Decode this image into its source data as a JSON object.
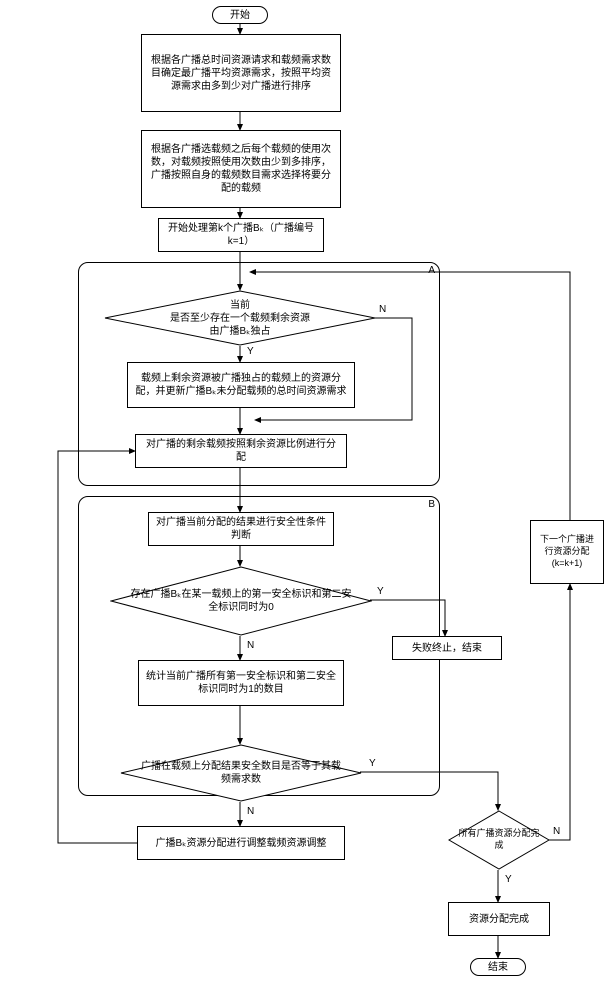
{
  "terminals": {
    "start": "开始",
    "end": "结束"
  },
  "steps": {
    "s1": "根据各广播总时间资源请求和载频需求数目确定最广播平均资源需求，按照平均资源需求由多到少对广播进行排序",
    "s2": "根据各广播选载频之后每个载频的使用次数，对载频按照使用次数由少到多排序，广播按照自身的载频数目需求选择将要分配的载频",
    "s3": "开始处理第k个广播Bₖ（广播编号k=1）",
    "s4": "载频上剩余资源被广播独占的载频上的资源分配，并更新广播Bₖ未分配载频的总时间资源需求",
    "s5": "对广播的剩余载频按照剩余资源比例进行分配",
    "s6": "对广播当前分配的结果进行安全性条件判断",
    "s7": "统计当前广播所有第一安全标识和第二安全标识同时为1的数目",
    "s8": "广播Bₖ资源分配进行调整载频资源调整",
    "s9": "失败终止，结束",
    "s10": "资源分配完成",
    "s11": "下一个广播进行资源分配(k=k+1)"
  },
  "decisions": {
    "d1": "当前\n是否至少存在一个载频剩余资源\n由广播Bₖ独占",
    "d2": "存在广播Bₖ在某一载频上的第一安全标识和第二安全标识同时为0",
    "d3": "广播在载频上分配结果安全数目是否等于其载频需求数",
    "d4": "所有广播资源分配完成"
  },
  "groups": {
    "A": "A",
    "B": "B"
  },
  "labels": {
    "Y": "Y",
    "N": "N"
  }
}
